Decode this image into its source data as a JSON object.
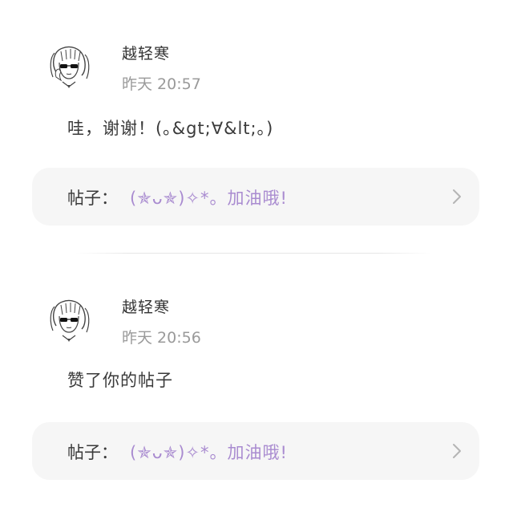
{
  "notifications": [
    {
      "username": "越轻寒",
      "time": "昨天 20:57",
      "content": "哇，谢谢！(｡&gt;∀&lt;｡)",
      "post_prefix": "帖子：",
      "post_title": "(✯ᴗ✯)✧*。加油哦!"
    },
    {
      "username": "越轻寒",
      "time": "昨天 20:56",
      "content": "赞了你的帖子",
      "post_prefix": "帖子：",
      "post_title": "(✯ᴗ✯)✧*。加油哦!"
    }
  ],
  "colors": {
    "accent": "#a98bd0",
    "muted": "#9a9a9a",
    "card_bg": "#f6f6f6"
  },
  "icons": [
    "avatar-girl-sunglasses",
    "chevron-right-icon"
  ]
}
